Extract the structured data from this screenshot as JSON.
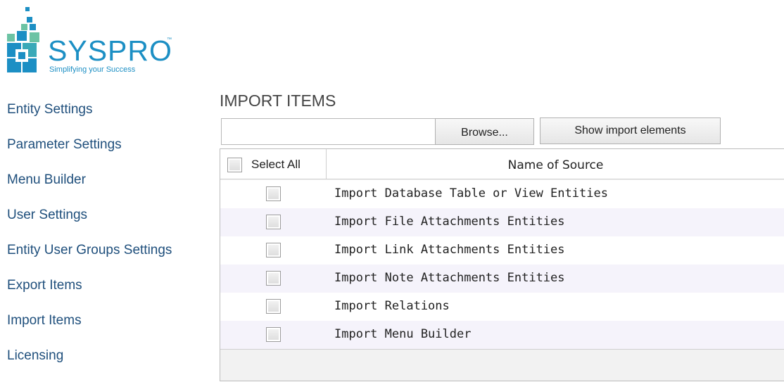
{
  "logo": {
    "word": "SYSPRO",
    "tm": "™",
    "tagline": "Simplifying your Success",
    "color": "#1c8fc4"
  },
  "sidebar": {
    "items": [
      {
        "label": "Entity Settings"
      },
      {
        "label": "Parameter Settings"
      },
      {
        "label": "Menu Builder"
      },
      {
        "label": "User Settings"
      },
      {
        "label": "Entity User Groups Settings"
      },
      {
        "label": "Export Items"
      },
      {
        "label": "Import Items"
      },
      {
        "label": "Licensing"
      }
    ],
    "color": "#1f4f7c"
  },
  "main": {
    "title": "IMPORT ITEMS",
    "file_input": {
      "value": "",
      "placeholder": ""
    },
    "browse_label": "Browse...",
    "show_elements_label": "Show import elements",
    "grid": {
      "select_all_label": "Select All",
      "column_header": "Name of Source",
      "rows": [
        {
          "name": "Import Database Table or View Entities",
          "checked": false
        },
        {
          "name": "Import File Attachments Entities",
          "checked": false
        },
        {
          "name": "Import Link Attachments Entities",
          "checked": false
        },
        {
          "name": "Import Note Attachments Entities",
          "checked": false
        },
        {
          "name": "Import Relations",
          "checked": false
        },
        {
          "name": "Import Menu Builder",
          "checked": false
        }
      ],
      "alt_row_color": "#f5f3fb"
    }
  }
}
